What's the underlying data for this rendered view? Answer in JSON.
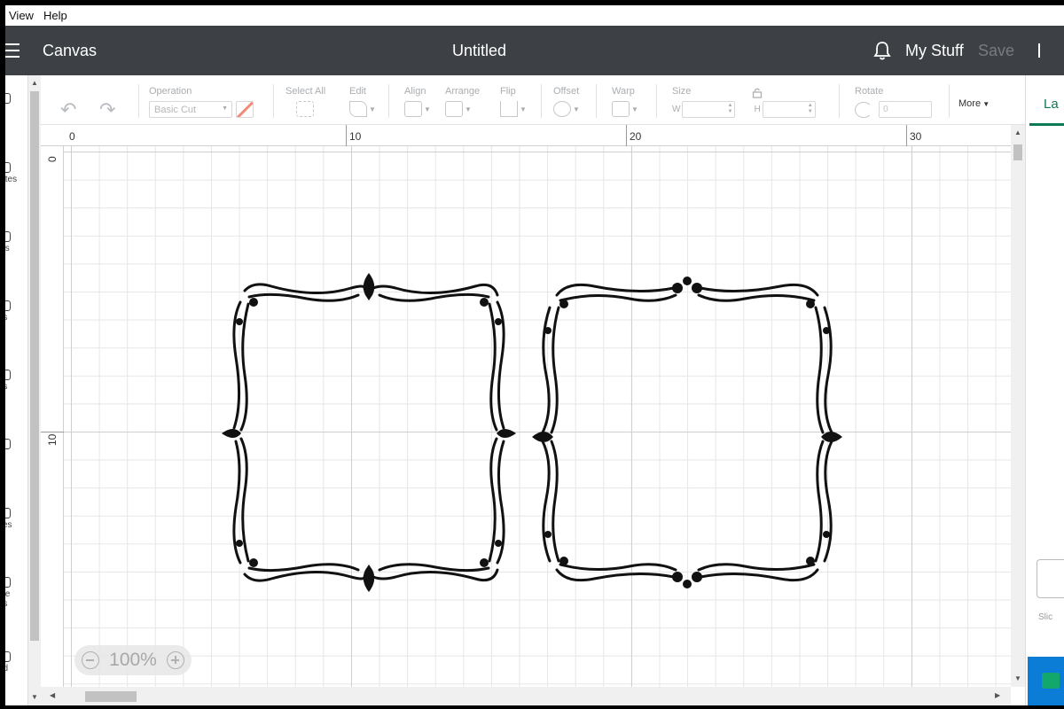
{
  "menubar": {
    "items": [
      "View",
      "Help"
    ]
  },
  "header": {
    "app_title": "Canvas",
    "doc_title": "Untitled",
    "my_stuff": "My Stuff",
    "save": "Save"
  },
  "toolbar": {
    "operation_label": "Operation",
    "operation_value": "Basic Cut",
    "select_all": "Select All",
    "edit": "Edit",
    "align": "Align",
    "arrange": "Arrange",
    "flip": "Flip",
    "offset": "Offset",
    "warp": "Warp",
    "size": "Size",
    "width_label": "W",
    "height_label": "H",
    "rotate": "Rotate",
    "rotate_value": "0",
    "more": "More"
  },
  "leftnav": {
    "items": [
      {
        "label": "w"
      },
      {
        "label": "lates"
      },
      {
        "label": "cts"
      },
      {
        "label": "es"
      },
      {
        "label": "es"
      },
      {
        "label": "t"
      },
      {
        "label": "ces"
      },
      {
        "label": "ble\nes"
      },
      {
        "label": "ad"
      }
    ]
  },
  "rightpanel": {
    "layers_tab": "La",
    "slice": "Slic"
  },
  "rulers": {
    "top": [
      "0",
      "10",
      "20",
      "30"
    ],
    "left": [
      "0",
      "10"
    ]
  },
  "zoom": {
    "level": "100%"
  },
  "colors": {
    "header_bg": "#3d4145",
    "accent": "#0c7a55",
    "frame": "#111111"
  }
}
